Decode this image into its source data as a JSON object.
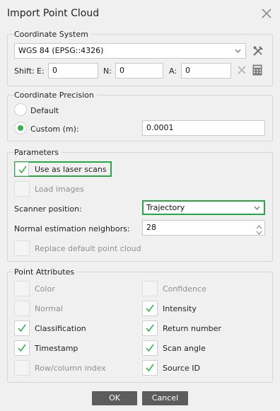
{
  "window": {
    "title": "Import Point Cloud",
    "close_icon": "close-icon"
  },
  "coordinate_system": {
    "legend": "Coordinate System",
    "selected": "WGS 84 (EPSG::4326)",
    "shift_label": "Shift:",
    "e_label": "E:",
    "e_value": "0",
    "n_label": "N:",
    "n_value": "0",
    "a_label": "A:",
    "a_value": "0"
  },
  "precision": {
    "legend": "Coordinate Precision",
    "default_label": "Default",
    "custom_label": "Custom (m):",
    "custom_value": "0.0001",
    "selected": "custom"
  },
  "parameters": {
    "legend": "Parameters",
    "laser_label": "Use as laser scans",
    "laser_checked": true,
    "load_images_label": "Load images",
    "scanner_label": "Scanner position:",
    "scanner_value": "Trajectory",
    "neighbors_label": "Normal estimation neighbors:",
    "neighbors_value": "28",
    "replace_label": "Replace default point cloud"
  },
  "attributes": {
    "legend": "Point Attributes",
    "items": [
      {
        "label": "Color",
        "checked": false,
        "enabled": false
      },
      {
        "label": "Confidence",
        "checked": false,
        "enabled": false
      },
      {
        "label": "Normal",
        "checked": false,
        "enabled": false
      },
      {
        "label": "Intensity",
        "checked": true,
        "enabled": true
      },
      {
        "label": "Classification",
        "checked": true,
        "enabled": true
      },
      {
        "label": "Return number",
        "checked": true,
        "enabled": true
      },
      {
        "label": "Timestamp",
        "checked": true,
        "enabled": true
      },
      {
        "label": "Scan angle",
        "checked": true,
        "enabled": true
      },
      {
        "label": "Row/column index",
        "checked": false,
        "enabled": false
      },
      {
        "label": "Source ID",
        "checked": true,
        "enabled": true
      }
    ]
  },
  "buttons": {
    "ok": "OK",
    "cancel": "Cancel"
  },
  "colors": {
    "accent": "#2fb84a",
    "highlight": "#27a844",
    "button": "#5c5c5c"
  }
}
